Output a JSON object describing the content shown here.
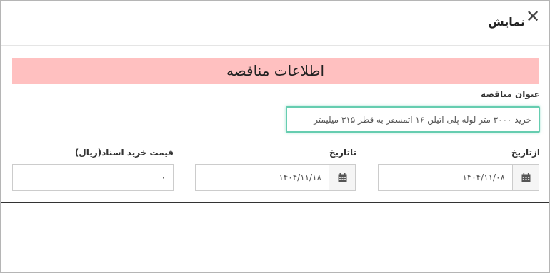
{
  "header": {
    "title": "نمایش",
    "close_label": "✕"
  },
  "section": {
    "title": "اطلاعات مناقصه"
  },
  "tender_title": {
    "label": "عنوان مناقصه",
    "value": "خرید ۳۰۰۰ متر لوله پلی اتیلن ۱۶ اتمسفر به قطر ۳۱۵ میلیمتر"
  },
  "from_date": {
    "label": "ازتاریخ",
    "value": "۱۴۰۴/۱۱/۰۸",
    "icon": "calendar-icon"
  },
  "to_date": {
    "label": "تاتاریخ",
    "value": "۱۴۰۴/۱۱/۱۸",
    "icon": "calendar-icon"
  },
  "doc_price": {
    "label": "قیمت خرید اسناد(ریال)",
    "value": "۰"
  },
  "colors": {
    "banner_bg": "#ffc0c0",
    "focus_border": "#66cdb0"
  }
}
